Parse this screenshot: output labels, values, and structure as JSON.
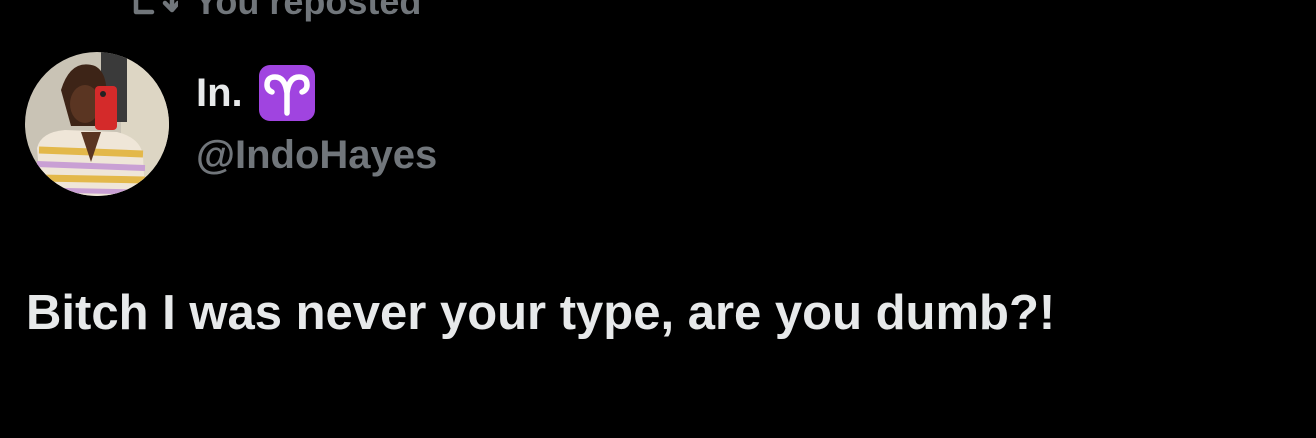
{
  "repost": {
    "label": "You reposted",
    "icon": "repost-icon"
  },
  "tweet": {
    "author": {
      "display_name": "In.",
      "badge_emoji": "♈",
      "badge_icon": "aries-zodiac-icon",
      "badge_color": "#a044e0",
      "handle": "@IndoHayes",
      "avatar_icon": "profile-photo"
    },
    "text": "Bitch I was never your type, are you dumb?!"
  },
  "colors": {
    "background": "#000000",
    "primary_text": "#e7e9ea",
    "secondary_text": "#71767b"
  }
}
